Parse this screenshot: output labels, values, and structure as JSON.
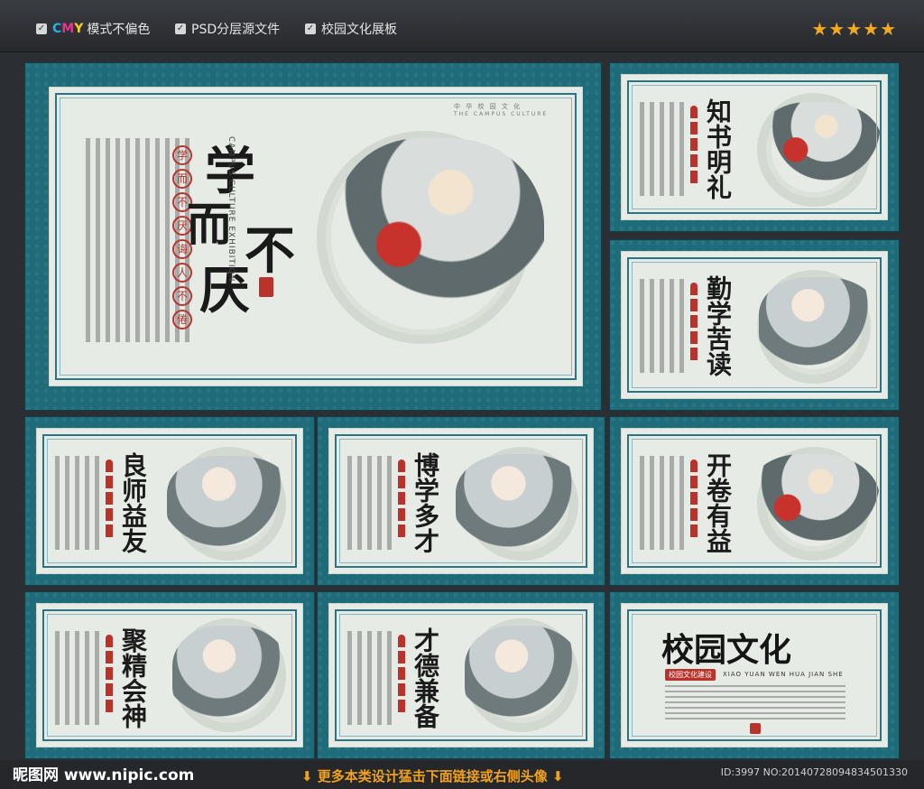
{
  "topbar": {
    "feature1_prefix_c": "C",
    "feature1_prefix_m": "M",
    "feature1_prefix_y": "Y",
    "feature1": "模式不偏色",
    "feature2": "PSD分层源文件",
    "feature3": "校园文化展板",
    "rating": "★★★★★"
  },
  "main_panel": {
    "title_chars": [
      "学",
      "而",
      "不",
      "厌"
    ],
    "pill_chars": [
      "学",
      "而",
      "不",
      "厌",
      "诲",
      "人",
      "不",
      "倦"
    ],
    "header": "中 华 校 园 文 化",
    "header_en": "THE CAMPUS CULTURE",
    "side_en": "CAMPUS CULTURE EXHIBITION"
  },
  "panels": [
    {
      "title": "知书明礼"
    },
    {
      "title": "勤学苦读"
    },
    {
      "title": "良师益友"
    },
    {
      "title": "博学多才"
    },
    {
      "title": "开卷有益"
    },
    {
      "title": "聚精会神"
    },
    {
      "title": "才德兼备"
    }
  ],
  "campus_panel": {
    "title": "校园文化",
    "banner": "校园文化建设",
    "pinyin": "XIAO YUAN WEN HUA JIAN SHE"
  },
  "bottom": {
    "logo": "昵图网 www.nipic.com",
    "cta": "更多本类设计猛击下面链接或右侧头像",
    "id": "ID:3997 NO:20140728094834501330"
  },
  "colors": {
    "panel_teal": "#1e6b7a",
    "seal_red": "#b9332b",
    "star_gold": "#f5a91c",
    "cta_orange": "#f0a21a"
  }
}
